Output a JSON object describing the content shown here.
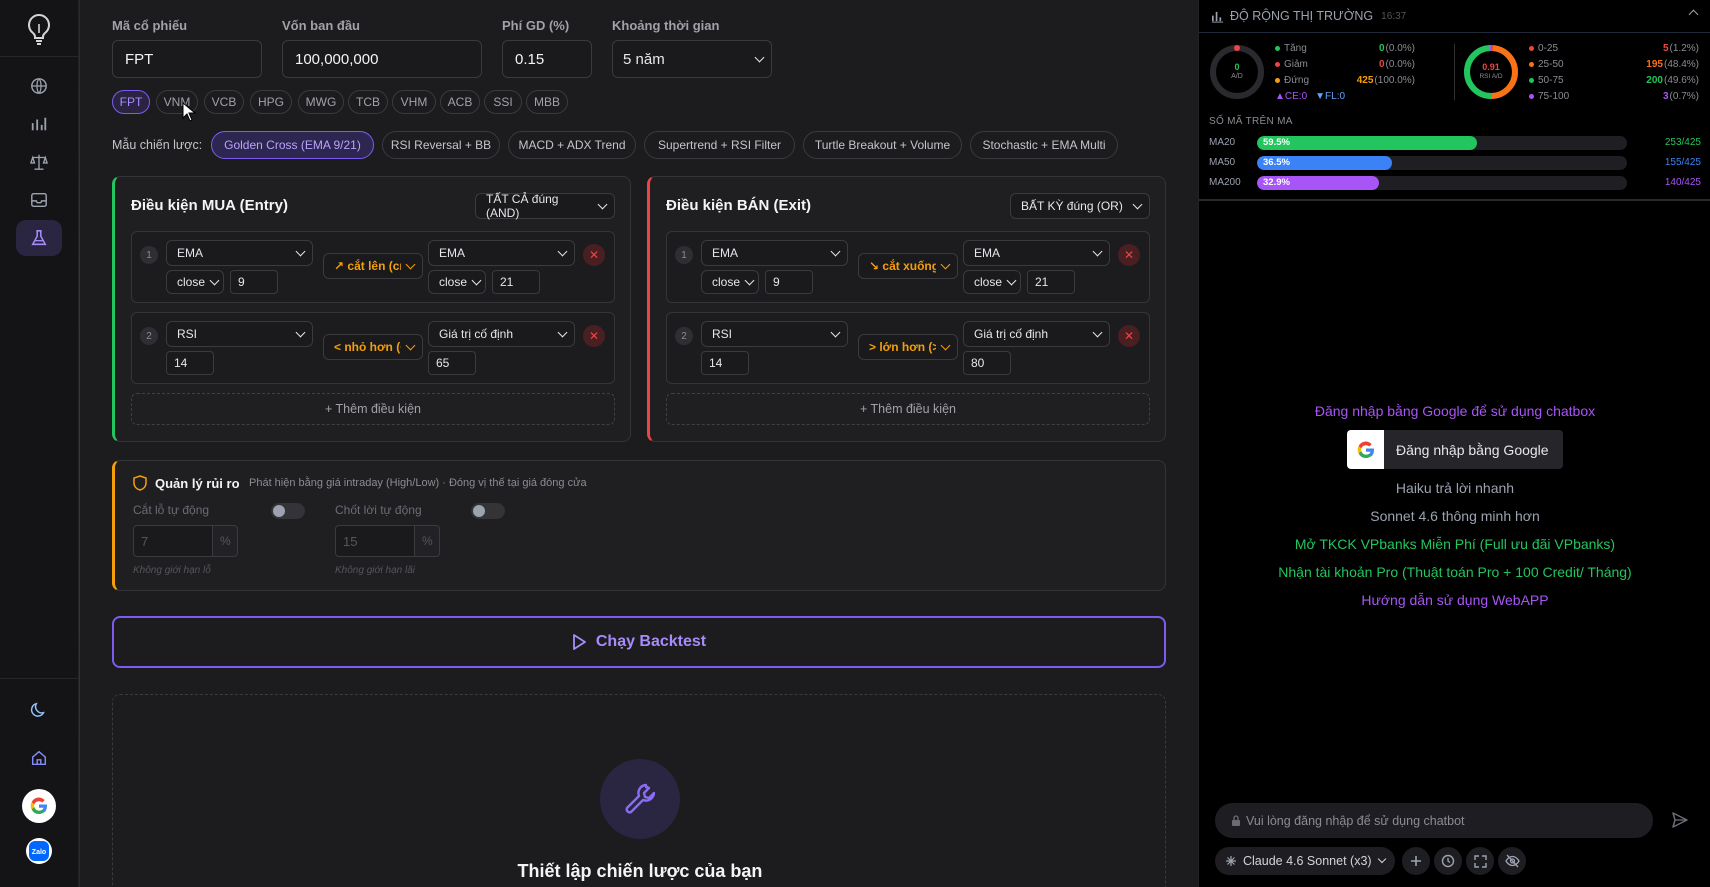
{
  "inputs": {
    "ticker_label": "Mã cổ phiếu",
    "ticker_value": "FPT",
    "capital_label": "Vốn ban đầu",
    "capital_value": "100,000,000",
    "fee_label": "Phí GD (%)",
    "fee_value": "0.15",
    "period_label": "Khoảng thời gian",
    "period_value": "5 năm"
  },
  "tickers": [
    "FPT",
    "VNM",
    "VCB",
    "HPG",
    "MWG",
    "TCB",
    "VHM",
    "ACB",
    "SSI",
    "MBB"
  ],
  "templates": {
    "label": "Mẫu chiến lược:",
    "items": [
      "Golden Cross (EMA 9/21)",
      "RSI Reversal + BB",
      "MACD + ADX Trend",
      "Supertrend + RSI Filter",
      "Turtle Breakout + Volume",
      "Stochastic + EMA Multi"
    ]
  },
  "buy": {
    "title": "Điều kiện MUA (Entry)",
    "mode": "TẤT CẢ đúng (AND)",
    "conditions": [
      {
        "idx": "1",
        "ind": "EMA",
        "src": "close",
        "period": "9",
        "op": "↗ cắt lên (cı",
        "rhs": "EMA",
        "rsrc": "close",
        "rperiod": "21"
      },
      {
        "idx": "2",
        "ind": "RSI",
        "period": "14",
        "op": "< nhỏ hơn (<",
        "rhs": "Giá trị cố định",
        "rval": "65"
      }
    ],
    "add": "+ Thêm điều kiện"
  },
  "sell": {
    "title": "Điều kiện BÁN (Exit)",
    "mode": "BẤT KỲ đúng (OR)",
    "conditions": [
      {
        "idx": "1",
        "ind": "EMA",
        "src": "close",
        "period": "9",
        "op": "↘ cắt xuống",
        "rhs": "EMA",
        "rsrc": "close",
        "rperiod": "21"
      },
      {
        "idx": "2",
        "ind": "RSI",
        "period": "14",
        "op": "> lớn hơn (>",
        "rhs": "Giá trị cố định",
        "rval": "80"
      }
    ],
    "add": "+ Thêm điều kiện"
  },
  "risk": {
    "title": "Quản lý rủi ro",
    "note": "Phát hiện bằng giá intraday (High/Low) · Đóng vị thế tại giá đóng cửa",
    "sl_label": "Cắt lỗ tự động",
    "sl_value": "7",
    "sl_hint": "Không giới hạn lỗ",
    "tp_label": "Chốt lời tự động",
    "tp_value": "15",
    "tp_hint": "Không giới hạn lãi",
    "pct": "%"
  },
  "run_label": "Chạy Backtest",
  "placeholder_title": "Thiết lập chiến lược của bạn",
  "market": {
    "title": "ĐỘ RỘNG THỊ TRƯỜNG",
    "time": "16:37",
    "ad_value": "0",
    "ad_label": "A/D",
    "rsi_value": "0.91",
    "rsi_label": "RSI A/D",
    "breadth": [
      {
        "label": "Tăng",
        "count": "0",
        "pct": "(0.0%)",
        "color": "#22c55e"
      },
      {
        "label": "Giảm",
        "count": "0",
        "pct": "(0.0%)",
        "color": "#ef4444"
      },
      {
        "label": "Đứng",
        "count": "425",
        "pct": "(100.0%)",
        "color": "#f59e0b"
      }
    ],
    "ce": "▲CE:0",
    "fl": "▼FL:0",
    "rsi_bins": [
      {
        "label": "0-25",
        "count": "5",
        "pct": "(1.2%)",
        "color": "#ef4444"
      },
      {
        "label": "25-50",
        "count": "195",
        "pct": "(48.4%)",
        "color": "#f97316"
      },
      {
        "label": "50-75",
        "count": "200",
        "pct": "(49.6%)",
        "color": "#22c55e"
      },
      {
        "label": "75-100",
        "count": "3",
        "pct": "(0.7%)",
        "color": "#a855f7"
      }
    ],
    "ma_title": "SỐ MÃ TRÊN MA",
    "ma": [
      {
        "name": "MA20",
        "pct_label": "59.5%",
        "pct": 59.5,
        "ratio": "253/425",
        "color": "#22c55e"
      },
      {
        "name": "MA50",
        "pct_label": "36.5%",
        "pct": 36.5,
        "ratio": "155/425",
        "color": "#3b82f6"
      },
      {
        "name": "MA200",
        "pct_label": "32.9%",
        "pct": 32.9,
        "ratio": "140/425",
        "color": "#a855f7"
      }
    ]
  },
  "chat": {
    "login_prompt": "Đăng nhập bằng Google để sử dụng chatbox",
    "google_btn": "Đăng nhập bằng Google",
    "line_haiku": "Haiku trả lời nhanh",
    "line_sonnet": "Sonnet 4.6 thông minh hơn",
    "line_vpbanks": "Mở TKCK VPbanks Miễn Phí (Full ưu đãi VPbanks)",
    "line_pro": "Nhận tài khoản Pro (Thuật toán Pro + 100 Credit/ Tháng)",
    "line_guide": "Hướng dẫn sử dụng WebAPP",
    "input_placeholder": "Vui lòng đăng nhập để sử dụng chatbot",
    "model": "Claude 4.6 Sonnet (x3)"
  },
  "colors": {
    "accent": "#7c5cf0",
    "buy": "#22c55e",
    "sell": "#ef4444",
    "risk": "#f59e0b"
  }
}
